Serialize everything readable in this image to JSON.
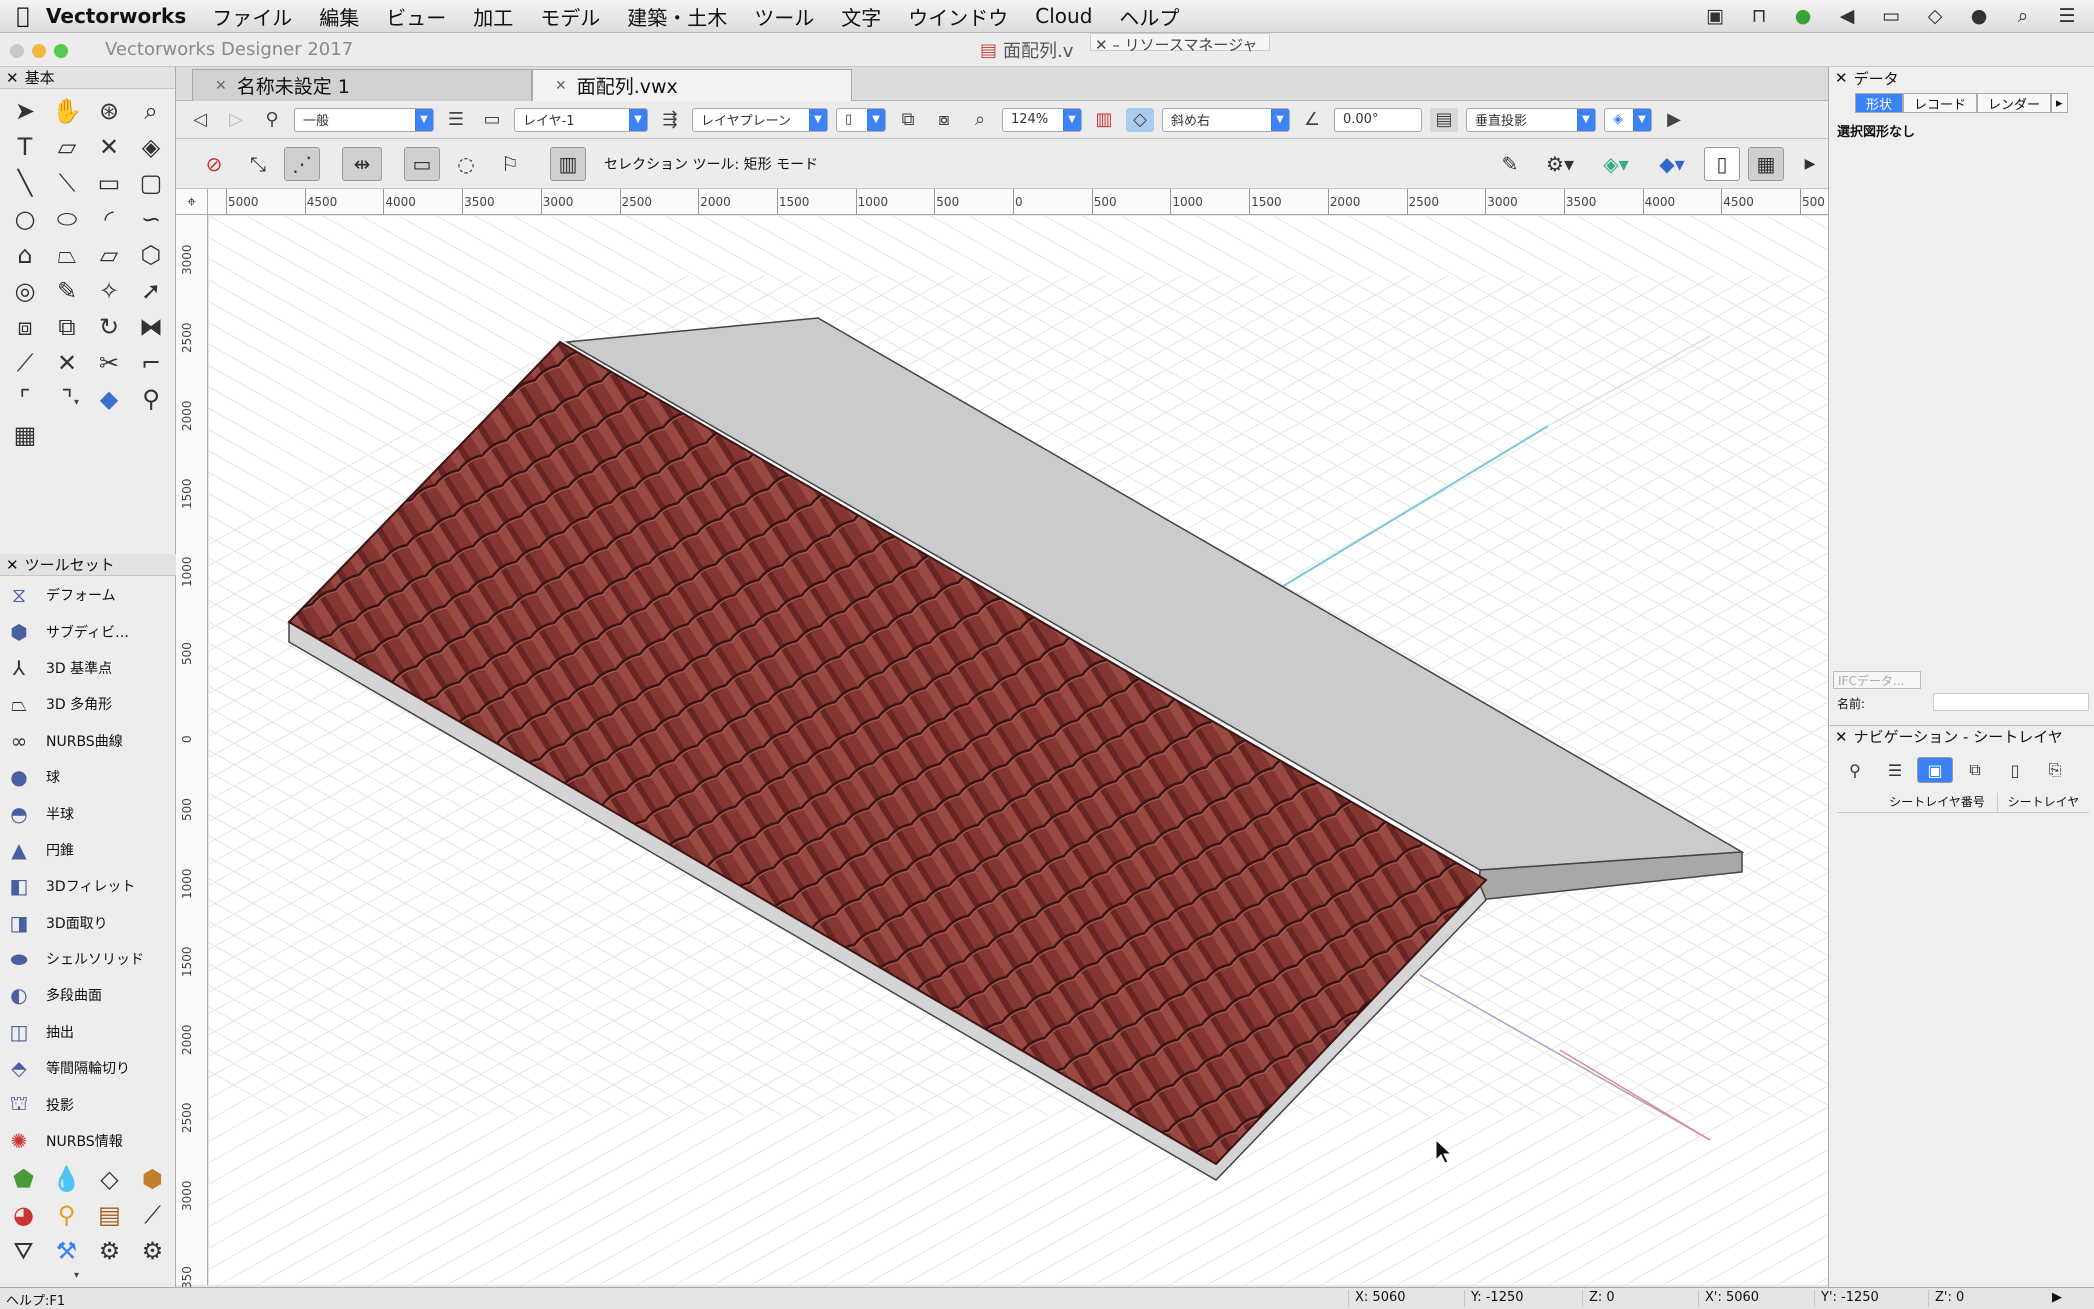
{
  "menubar": {
    "app_name": "Vectorworks",
    "items": [
      "ファイル",
      "編集",
      "ビュー",
      "加工",
      "モデル",
      "建築・土木",
      "ツール",
      "文字",
      "ウインドウ",
      "Cloud",
      "ヘルプ"
    ],
    "status_icons": [
      "camera-icon",
      "lock-icon",
      "record-icon",
      "volume-icon",
      "battery-icon",
      "wifi-icon",
      "user-icon",
      "spotlight-icon",
      "list-icon"
    ]
  },
  "window": {
    "title": "Vectorworks Designer 2017",
    "doc_title": "面配列.v",
    "resource_manager": "リソースマネージャ"
  },
  "left_panel": {
    "title": "基本",
    "toolset_title": "ツールセット",
    "toolsets": [
      {
        "label": "デフォーム",
        "icon": "deform-icon"
      },
      {
        "label": "サブディビ…",
        "icon": "subdivision-icon"
      },
      {
        "label": "3D 基準点",
        "icon": "3d-locus-icon"
      },
      {
        "label": "3D 多角形",
        "icon": "3d-polygon-icon"
      },
      {
        "label": "NURBS曲線",
        "icon": "nurbs-curve-icon"
      },
      {
        "label": "球",
        "icon": "sphere-icon"
      },
      {
        "label": "半球",
        "icon": "hemisphere-icon"
      },
      {
        "label": "円錐",
        "icon": "cone-icon"
      },
      {
        "label": "3Dフィレット",
        "icon": "3d-fillet-icon"
      },
      {
        "label": "3D面取り",
        "icon": "3d-chamfer-icon"
      },
      {
        "label": "シェルソリッド",
        "icon": "shell-solid-icon"
      },
      {
        "label": "多段曲面",
        "icon": "loft-surface-icon"
      },
      {
        "label": "抽出",
        "icon": "extract-icon"
      },
      {
        "label": "等間隔輪切り",
        "icon": "contour-icon"
      },
      {
        "label": "投影",
        "icon": "project-icon"
      },
      {
        "label": "NURBS情報",
        "icon": "nurbs-info-icon"
      }
    ]
  },
  "tabs": [
    {
      "label": "名称未設定 1"
    },
    {
      "label": "面配列.vwx"
    }
  ],
  "view_bar": {
    "class": "一般",
    "layer": "レイヤ-1",
    "plane": "レイヤプレーン",
    "zoom": "124%",
    "view": "斜め右",
    "angle": "0.00°",
    "projection": "垂直投影"
  },
  "mode_bar": {
    "tool_label": "セレクション ツール: 矩形 モード"
  },
  "ruler": {
    "h_ticks": [
      "5000",
      "4500",
      "4000",
      "3500",
      "3000",
      "2500",
      "2000",
      "1500",
      "1000",
      "500",
      "0",
      "500",
      "1000",
      "1500",
      "2000",
      "2500",
      "3000",
      "3500",
      "4000",
      "4500",
      "500"
    ],
    "v_ticks": [
      "3000",
      "2500",
      "2000",
      "1500",
      "1000",
      "500",
      "0",
      "500",
      "1000",
      "1500",
      "2000",
      "2500",
      "3000",
      "350"
    ]
  },
  "right_panel": {
    "title": "データ",
    "tabs": [
      "形状",
      "レコード",
      "レンダー"
    ],
    "no_selection": "選択図形なし",
    "ifc_button": "IFCデータ...",
    "name_label": "名前:",
    "nav_title": "ナビゲーション - シートレイヤ",
    "nav_columns": [
      "シートレイヤ番号",
      "シートレイヤ"
    ]
  },
  "status": {
    "help": "ヘルプ:F1",
    "x": "X: 5060",
    "y": "Y: -1250",
    "z": "Z: 0",
    "x2": "X': 5060",
    "y2": "Y': -1250",
    "z2": "Z': 0"
  },
  "colors": {
    "roof_tile": "#8e3a36",
    "roof_slab": "#cbcbcb",
    "accent": "#3b82f6"
  }
}
